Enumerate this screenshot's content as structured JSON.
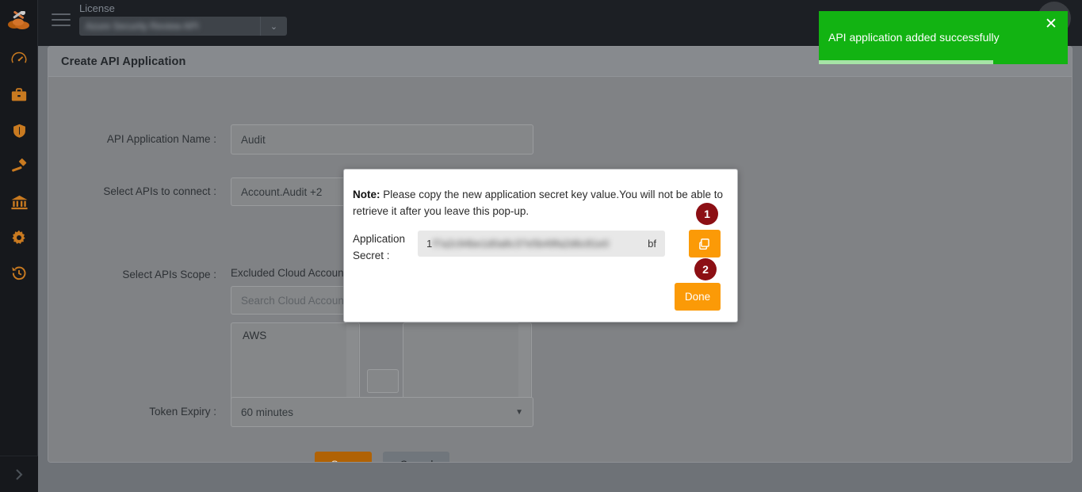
{
  "topbar": {
    "menu_icon": "hamburger-icon",
    "license_label": "License",
    "license_value": "Azure Security Review API",
    "license_caret": "⌄",
    "avatar_icon": "user-avatar"
  },
  "sidebar": {
    "logo_icon": "cloud-tools-logo",
    "expand_icon": "chevron-right-icon",
    "items": [
      {
        "name": "dashboard",
        "icon": "gauge-icon"
      },
      {
        "name": "business",
        "icon": "briefcase-icon"
      },
      {
        "name": "security",
        "icon": "shield-icon"
      },
      {
        "name": "remediation",
        "icon": "gavel-icon"
      },
      {
        "name": "governance",
        "icon": "bank-icon"
      },
      {
        "name": "settings",
        "icon": "gear-icon"
      },
      {
        "name": "history",
        "icon": "history-icon"
      }
    ]
  },
  "card": {
    "title": "Create API Application"
  },
  "form": {
    "name_label": "API Application Name :",
    "name_value": "Audit",
    "apis_label": "Select APIs to connect :",
    "apis_value": "Account.Audit +2",
    "clear_icon": "clear-circle-icon",
    "scope_label": "Select APIs Scope :",
    "scope_caption": "Excluded Cloud Account",
    "search_placeholder": "Search Cloud Account",
    "available_items": [
      "AWS"
    ],
    "selected_items": [],
    "transfer_forward_label": "»",
    "transfer_back_label": "«",
    "token_label": "Token Expiry :",
    "token_value": "60 minutes",
    "token_caret": "▼",
    "save_label": "Save",
    "cancel_label": "Cancel"
  },
  "modal": {
    "note_prefix": "Note:",
    "note_text": " Please copy the new application secret key value.You will not be able to retrieve it after you leave this pop-up.",
    "secret_label": "Application Secret :",
    "secret_prefix": "1",
    "secret_masked": "f7a2c94be1d0a8c37e5b49fa2d6c81e0",
    "secret_suffix": "bf",
    "copy_icon": "copy-pages-icon",
    "copy_badge": "1",
    "done_label": "Done",
    "done_badge": "2"
  },
  "toast": {
    "message": "API application added successfully",
    "close_icon": "✕",
    "accent_color": "#12b312",
    "progress_percent": 70
  }
}
